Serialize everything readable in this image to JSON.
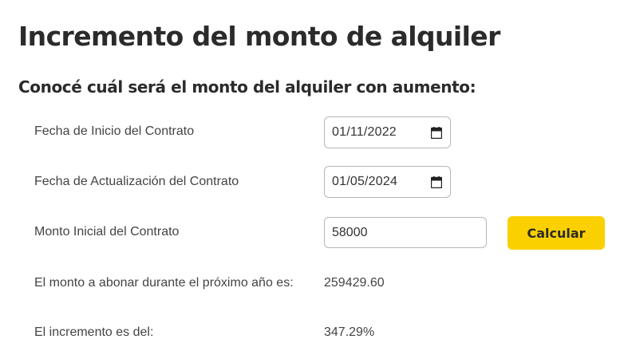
{
  "page": {
    "title": "Incremento del monto de alquiler",
    "subtitle": "Conocé cuál será el monto del alquiler con aumento:"
  },
  "form": {
    "start_date": {
      "label": "Fecha de Inicio del Contrato",
      "value": "01/11/2022",
      "icon": "calendar-icon"
    },
    "update_date": {
      "label": "Fecha de Actualización del Contrato",
      "value": "01/05/2024",
      "icon": "calendar-icon"
    },
    "initial_amount": {
      "label": "Monto Inicial del Contrato",
      "value": "58000"
    },
    "calculate_button": {
      "label": "Calcular",
      "color": "#fad000"
    }
  },
  "results": {
    "next_year_amount": {
      "label": "El monto a abonar durante el próximo año es:",
      "value": "259429.60"
    },
    "increase": {
      "label": "El incremento es del:",
      "value": "347.29%"
    }
  }
}
